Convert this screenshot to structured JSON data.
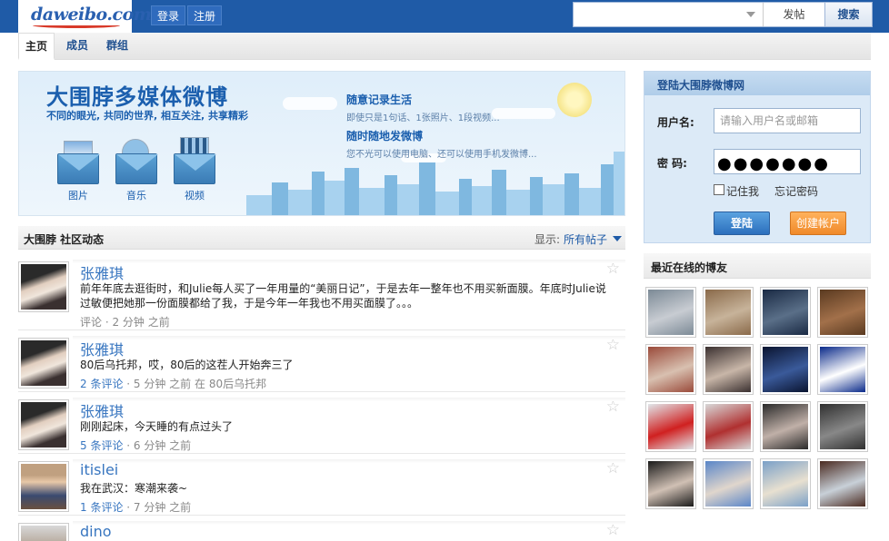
{
  "header": {
    "logo_text": "daweibo.com",
    "links": [
      {
        "label": "登录"
      },
      {
        "label": "注册"
      }
    ],
    "search": {
      "placeholder": "",
      "post_label": "发帖",
      "search_label": "搜索"
    }
  },
  "nav": {
    "tabs": [
      {
        "label": "主页",
        "active": true
      },
      {
        "label": "成员"
      },
      {
        "label": "群组"
      }
    ]
  },
  "banner": {
    "title": "大围脖多媒体微博",
    "subtitle": "不同的眼光, 共同的世界, 相互关注, 共享精彩",
    "features": [
      {
        "title": "随意记录生活",
        "desc": "即使只是1句话、1张照片、1段视频..."
      },
      {
        "title": "随时随地发微博",
        "desc": "您不光可以使用电脑、还可以使用手机发微博..."
      }
    ],
    "media": [
      {
        "label": "图片",
        "icon": "photo-icon"
      },
      {
        "label": "音乐",
        "icon": "music-icon"
      },
      {
        "label": "视频",
        "icon": "video-icon"
      }
    ]
  },
  "feed": {
    "title": "大围脖 社区动态",
    "filter_label": "显示:",
    "filter_value": "所有帖子",
    "items": [
      {
        "author": "张雅琪",
        "text": "前年年底去逛街时，和Julie每人买了一年用量的“美丽日记”，于是去年一整年也不用买新面膜。年底时Julie说过敏便把她那一份面膜都给了我，于是今年一年我也不用买面膜了。。。",
        "comments": "评论",
        "time": "2 分钟 之前",
        "location": ""
      },
      {
        "author": "张雅琪",
        "text": "80后乌托邦，哎，80后的这茬人开始奔三了",
        "comments": "2 条评论",
        "time": "5 分钟 之前",
        "location": "在 80后乌托邦"
      },
      {
        "author": "张雅琪",
        "text": "刚刚起床，今天睡的有点过头了",
        "comments": "5 条评论",
        "time": "6 分钟 之前",
        "location": ""
      },
      {
        "author": "itislei",
        "text": "我在武汉：寒潮来袭~",
        "comments": "1 条评论",
        "time": "7 分钟 之前",
        "location": ""
      },
      {
        "author": "dino",
        "text": "",
        "comments": "",
        "time": "",
        "location": ""
      }
    ]
  },
  "login": {
    "title": "登陆大围脖微博网",
    "username_label": "用户名:",
    "username_placeholder": "请输入用户名或邮箱",
    "password_label": "密 码:",
    "password_mask": "●●●●●●●",
    "remember_label": "记住我",
    "forgot_label": "忘记密码",
    "login_button": "登陆",
    "create_button": "创建帐户"
  },
  "online": {
    "title": "最近在线的博友",
    "thumb_colors": [
      [
        "#7c8a96",
        "#c8ccd2"
      ],
      [
        "#8a6a4a",
        "#c7b39a"
      ],
      [
        "#1a2a44",
        "#5a6f88"
      ],
      [
        "#5a3a20",
        "#a2704a"
      ],
      [
        "#9a4a3a",
        "#d8c0b0"
      ],
      [
        "#3a3030",
        "#c8b6a8"
      ],
      [
        "#0a1430",
        "#3a5a9a"
      ],
      [
        "#0a2a8a",
        "#ffffff"
      ],
      [
        "#e0e6ea",
        "#d02020"
      ],
      [
        "#d8d8d8",
        "#b03030"
      ],
      [
        "#2a2a2a",
        "#c0b0a8"
      ],
      [
        "#303030",
        "#888888"
      ],
      [
        "#1a1a1a",
        "#d0c0b4"
      ],
      [
        "#5a86c8",
        "#e0d6cc"
      ],
      [
        "#7aa0c8",
        "#e8e0d0"
      ],
      [
        "#4a2a20",
        "#c8d0d8"
      ]
    ]
  }
}
